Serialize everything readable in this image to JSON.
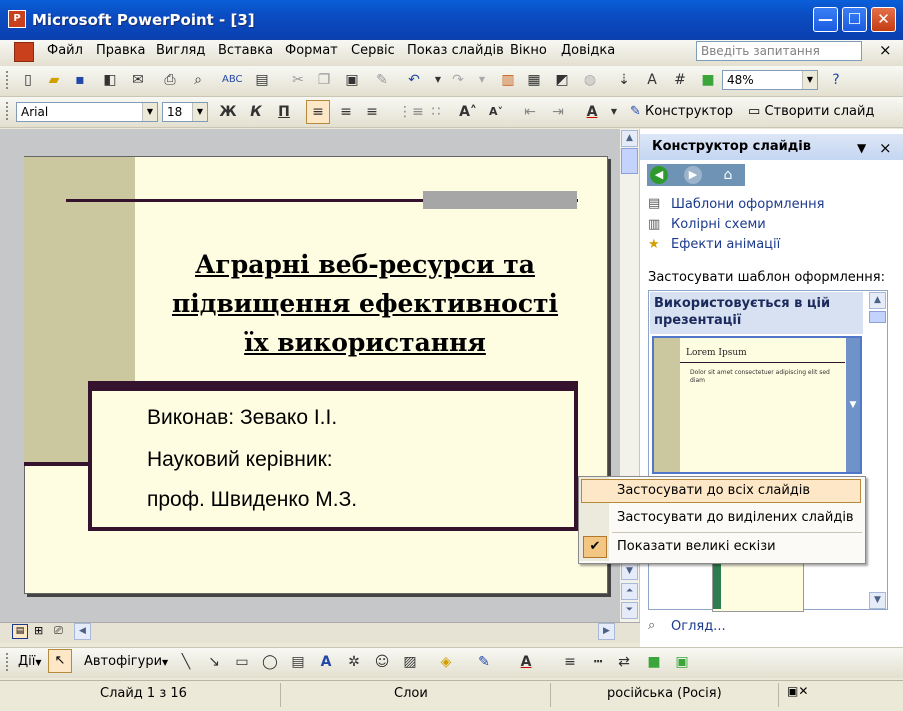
{
  "window": {
    "title": "Microsoft PowerPoint - [3]",
    "app_icon_letter": "P",
    "minimize": "—",
    "maximize": "☐",
    "close": "✕"
  },
  "menu": {
    "items": [
      "Файл",
      "Правка",
      "Вигляд",
      "Вставка",
      "Формат",
      "Сервіс",
      "Показ слайдів",
      "Вікно",
      "Довідка"
    ],
    "help_placeholder": "Введіть запитання",
    "close_doc": "×"
  },
  "standard_toolbar": {
    "zoom": "48%"
  },
  "format_toolbar": {
    "font": "Arial",
    "size": "18",
    "bold": "Ж",
    "italic": "К",
    "underline": "П",
    "designer_button": "Конструктор",
    "new_slide_button": "Створити слайд"
  },
  "slide": {
    "title_lines": [
      "Аграрні веб-ресурси та",
      "підвищення ефективності",
      "їх використання"
    ],
    "body_lines": [
      "Виконав: Зевако І.І.",
      "Науковий керівник:",
      "проф. Швиденко М.З."
    ]
  },
  "task_pane": {
    "title": "Конструктор слайдів",
    "links": [
      "Шаблони оформлення",
      "Колірні схеми",
      "Ефекти анімації"
    ],
    "apply_label": "Застосувати шаблон оформлення:",
    "group_heading": "Використовується в цій презентації",
    "thumb_title": "Lorem Ipsum",
    "thumb_bullet": "Dolor sit amet consectetuer adipiscing elit sed diam",
    "browse_link": "Огляд..."
  },
  "context_menu": {
    "items": [
      "Застосувати до всіх слайдів",
      "Застосувати до виділених слайдів",
      "Показати великі ескізи"
    ],
    "check_mark": "✔"
  },
  "drawing_toolbar": {
    "actions": "Дії",
    "autoshapes": "Автофігури"
  },
  "status": {
    "slide": "Слайд 1 з 16",
    "layout": "Слои",
    "language": "російська (Росія)"
  },
  "colors": {
    "title_bar": "#0b4cc2",
    "slide_bg": "#fffde1",
    "accent_dark": "#35122d",
    "band": "#cbc79e",
    "highlight": "#fde7c6"
  }
}
